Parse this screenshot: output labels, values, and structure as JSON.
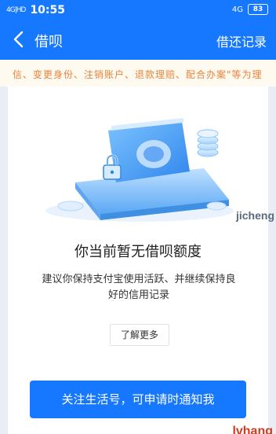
{
  "status_bar": {
    "signal_label": "4G|HD",
    "time": "10:55",
    "network": "4G",
    "battery": "83"
  },
  "nav": {
    "title": "借呗",
    "records_link": "借还记录"
  },
  "notice": {
    "text": "信、变更身份、注销账户、退款理赔、配合办案\"等为理"
  },
  "empty_state": {
    "title": "你当前暂无借呗额度",
    "description": "建议你保持支付宝使用活跃、并继续保持良好的信用记录",
    "learn_more": "了解更多"
  },
  "follow_button": "关注生活号，可申请时通知我",
  "watermark": "jicheng",
  "watermark_bottom": "lvhang",
  "colors": {
    "brand_blue": "#1677ff",
    "notice_orange": "#e9833c"
  }
}
